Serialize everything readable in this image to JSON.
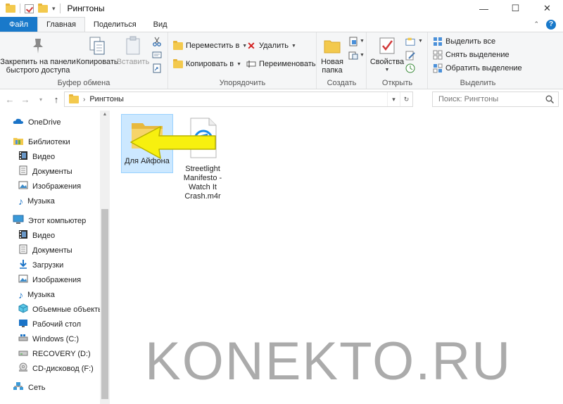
{
  "window": {
    "title": "Рингтоны",
    "controls": {
      "minimize": "—",
      "maximize": "☐",
      "close": "✕"
    }
  },
  "ribbon_tabs": [
    {
      "label": "Файл"
    },
    {
      "label": "Главная"
    },
    {
      "label": "Поделиться"
    },
    {
      "label": "Вид"
    }
  ],
  "ribbon": {
    "clipboard": {
      "label": "Буфер обмена",
      "pin_line1": "Закрепить на панели",
      "pin_line2": "быстрого доступа",
      "copy": "Копировать",
      "paste": "Вставить"
    },
    "organize": {
      "label": "Упорядочить",
      "move_to": "Переместить в",
      "copy_to": "Копировать в",
      "delete": "Удалить",
      "rename": "Переименовать"
    },
    "new": {
      "label": "Создать",
      "new_folder_line1": "Новая",
      "new_folder_line2": "папка"
    },
    "open": {
      "label": "Открыть",
      "properties": "Свойства"
    },
    "select": {
      "label": "Выделить",
      "select_all": "Выделить все",
      "select_none": "Снять выделение",
      "invert": "Обратить выделение"
    }
  },
  "address": {
    "path": "Рингтоны",
    "search_placeholder": "Поиск: Рингтоны"
  },
  "sidebar": {
    "onedrive": "OneDrive",
    "libraries": "Библиотеки",
    "lib_items": [
      "Видео",
      "Документы",
      "Изображения",
      "Музыка"
    ],
    "this_pc": "Этот компьютер",
    "pc_items": [
      "Видео",
      "Документы",
      "Загрузки",
      "Изображения",
      "Музыка",
      "Объемные объекты",
      "Рабочий стол",
      "Windows (C:)",
      "RECOVERY (D:)",
      "CD-дисковод (F:)"
    ],
    "network": "Сеть"
  },
  "files": [
    {
      "name": "Для Айфона",
      "type": "folder",
      "selected": true
    },
    {
      "name_lines": [
        "Streetlight",
        "Manifesto -",
        "Watch It",
        "Crash.m4r"
      ],
      "type": "m4r",
      "selected": false
    }
  ],
  "watermark": "KONEKTO.RU",
  "colors": {
    "file_tab": "#1979ca",
    "selection": "#cce8ff",
    "folder": "#f3c94d",
    "arrow": "#f7f00f"
  }
}
